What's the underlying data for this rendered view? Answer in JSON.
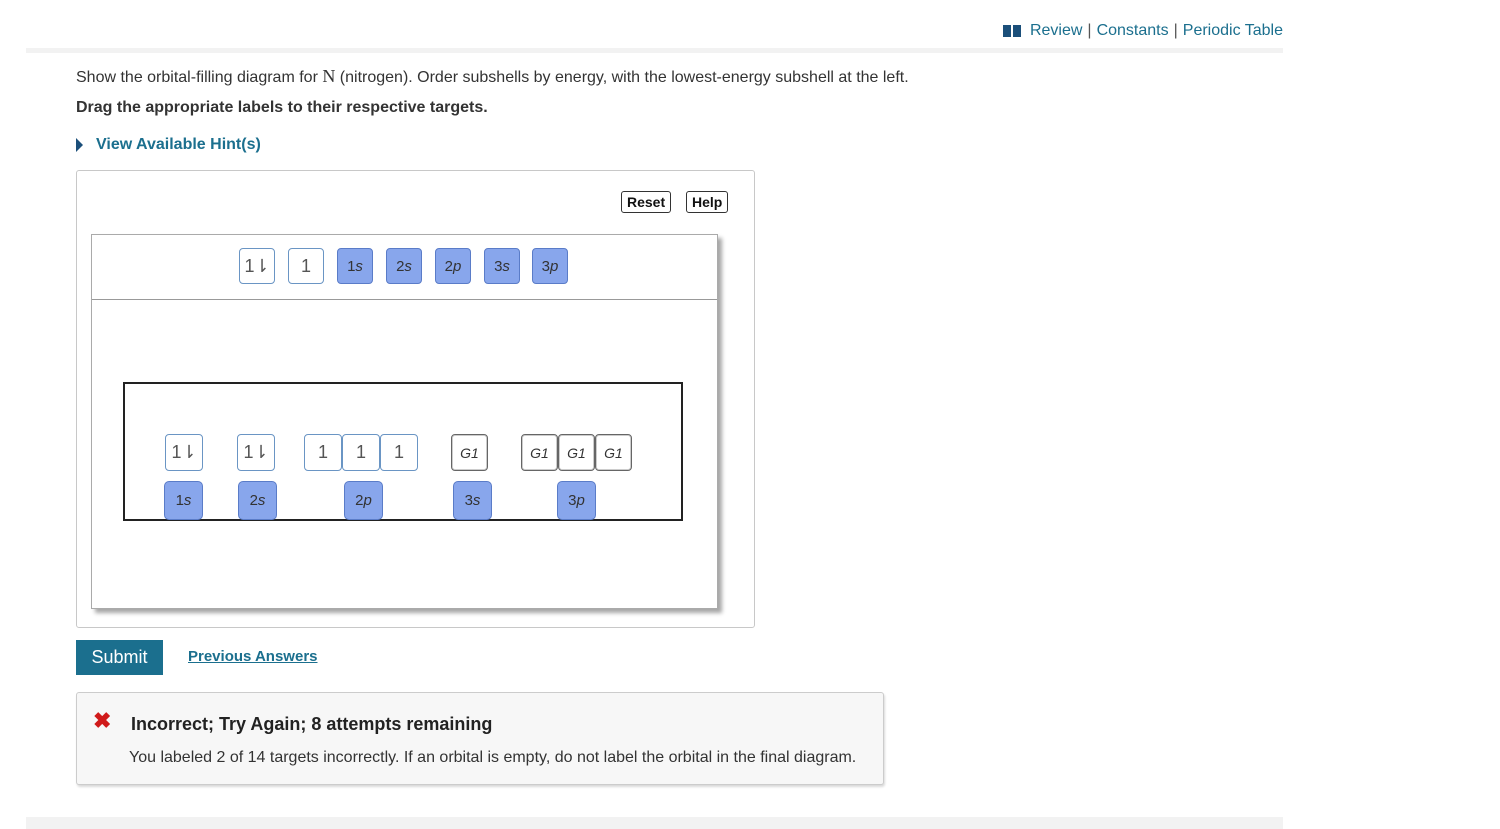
{
  "header": {
    "links": [
      "Review",
      "Constants",
      "Periodic Table"
    ],
    "separator": "|"
  },
  "question": {
    "prefix": "Show the orbital-filling diagram for ",
    "element_symbol": "N",
    "suffix": " (nitrogen). Order subshells by energy, with the lowest-energy subshell at the left.",
    "instruction": "Drag the appropriate labels to their respective targets.",
    "hints_label": "View Available Hint(s)"
  },
  "widget": {
    "reset_label": "Reset",
    "help_label": "Help",
    "palette": [
      {
        "kind": "arrow",
        "text": "1⇂"
      },
      {
        "kind": "arrow",
        "text": "1"
      },
      {
        "kind": "label",
        "num": "1",
        "letter": "s"
      },
      {
        "kind": "label",
        "num": "2",
        "letter": "s"
      },
      {
        "kind": "label",
        "num": "2",
        "letter": "p"
      },
      {
        "kind": "label",
        "num": "3",
        "letter": "s"
      },
      {
        "kind": "label",
        "num": "3",
        "letter": "p"
      }
    ],
    "orbitals": [
      {
        "text": "1⇂"
      },
      {
        "text": "1⇂"
      },
      {
        "text": "1"
      },
      {
        "text": "1"
      },
      {
        "text": "1"
      },
      {
        "text": "G1"
      },
      {
        "text": "G1"
      },
      {
        "text": "G1"
      },
      {
        "text": "G1"
      }
    ],
    "subshell_labels": [
      {
        "num": "1",
        "letter": "s"
      },
      {
        "num": "2",
        "letter": "s"
      },
      {
        "num": "2",
        "letter": "p"
      },
      {
        "num": "3",
        "letter": "s"
      },
      {
        "num": "3",
        "letter": "p"
      }
    ]
  },
  "actions": {
    "submit_label": "Submit",
    "previous_answers_label": "Previous Answers"
  },
  "feedback": {
    "icon": "x-icon",
    "title": "Incorrect; Try Again; 8 attempts remaining",
    "message": "You labeled 2 of 14 targets incorrectly. If an orbital is empty, do not label the orbital in the final diagram.",
    "status_color": "#d01a1a"
  }
}
